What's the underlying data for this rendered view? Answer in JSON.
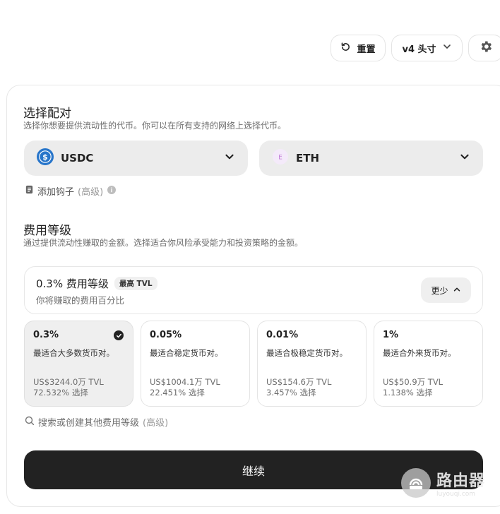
{
  "topbar": {
    "reset_label": "重置",
    "version_label": "v4 头寸"
  },
  "pair": {
    "title": "选择配对",
    "subtitle": "选择你想要提供流动性的代币。你可以在所有支持的网络上选择代币。",
    "token_a": {
      "symbol": "USDC",
      "icon": "usdc-icon",
      "color": "#2775ca"
    },
    "token_b": {
      "symbol": "ETH",
      "icon": "eth-icon",
      "icon_text": "E",
      "color": "#f2e8fb"
    },
    "hook_label": "添加钩子",
    "hook_advanced": "(高级)"
  },
  "fee": {
    "title": "费用等级",
    "subtitle": "通过提供流动性赚取的金额。选择适合你风险承受能力和投资策略的金额。",
    "header": {
      "title": "0.3% 费用等级",
      "badge": "最高 TVL",
      "subtitle": "你将赚取的费用百分比",
      "less_label": "更少"
    },
    "tiers": [
      {
        "pct": "0.3%",
        "desc": "最适合大多数货币对。",
        "tvl": "US$3244.0万 TVL",
        "select": "72.532% 选择",
        "selected": true
      },
      {
        "pct": "0.05%",
        "desc": "最适合稳定货币对。",
        "tvl": "US$1004.1万 TVL",
        "select": "22.451% 选择",
        "selected": false
      },
      {
        "pct": "0.01%",
        "desc": "最适合极稳定货币对。",
        "tvl": "US$154.6万 TVL",
        "select": "3.457% 选择",
        "selected": false
      },
      {
        "pct": "1%",
        "desc": "最适合外来货币对。",
        "tvl": "US$50.9万 TVL",
        "select": "1.138% 选择",
        "selected": false
      }
    ],
    "search_label": "搜索或创建其他费用等级",
    "search_advanced": "(高级)"
  },
  "continue_label": "继续",
  "watermark": {
    "main": "路由器",
    "url": "luyouqi.com"
  }
}
